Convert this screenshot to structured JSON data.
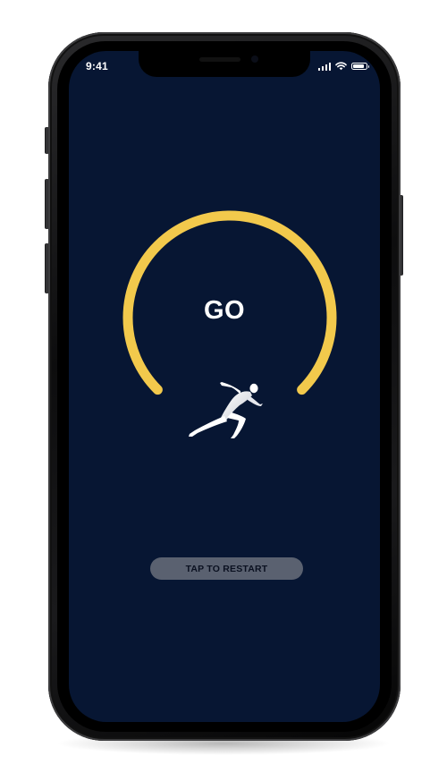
{
  "status_bar": {
    "time": "9:41",
    "icons": [
      "signal-icon",
      "wifi-icon",
      "battery-icon"
    ],
    "battery_level": 0.85
  },
  "timer": {
    "label": "GO",
    "icon": "runner-icon",
    "progress": 1.0,
    "ring_color": "#F2C94C"
  },
  "actions": {
    "restart_label": "TAP TO RESTART"
  },
  "colors": {
    "screen_background": "#071633",
    "button_background": "#5A6170",
    "text": "#FFFFFF"
  }
}
